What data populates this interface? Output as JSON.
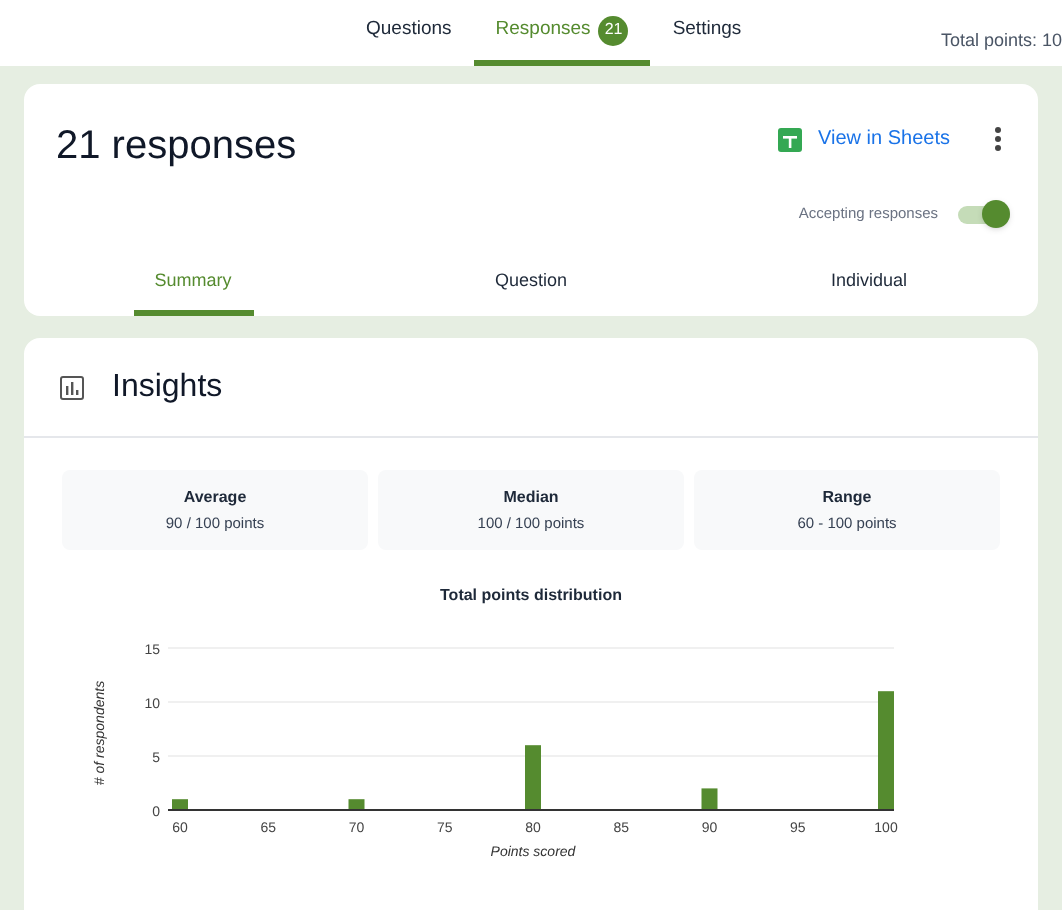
{
  "nav": {
    "tabs": [
      {
        "label": "Questions",
        "selected": false
      },
      {
        "label": "Responses",
        "selected": true,
        "badge": "21"
      },
      {
        "label": "Settings",
        "selected": false
      }
    ],
    "total_points": "Total points: 10"
  },
  "summary_card": {
    "title": "21 responses",
    "sheets_link": "View in Sheets",
    "accepting": {
      "label": "Accepting responses",
      "on": true
    },
    "tabs": [
      {
        "label": "Summary",
        "selected": true
      },
      {
        "label": "Question",
        "selected": false
      },
      {
        "label": "Individual",
        "selected": false
      }
    ]
  },
  "insights": {
    "title": "Insights",
    "stats": [
      {
        "label": "Average",
        "value": "90 / 100 points"
      },
      {
        "label": "Median",
        "value": "100 / 100 points"
      },
      {
        "label": "Range",
        "value": "60 - 100 points"
      }
    ],
    "chart_data": {
      "type": "bar",
      "title": "Total points distribution",
      "xlabel": "Points scored",
      "ylabel": "# of respondents",
      "x": [
        60,
        70,
        80,
        90,
        100
      ],
      "series": [
        {
          "color": "#558b2f",
          "values": [
            1,
            1,
            6,
            2,
            11
          ]
        }
      ],
      "xlim": [
        60,
        100
      ],
      "ylim": [
        0,
        15
      ],
      "xticks": [
        60,
        65,
        70,
        75,
        80,
        85,
        90,
        95,
        100
      ],
      "yticks": [
        0,
        5,
        10,
        15
      ]
    }
  }
}
